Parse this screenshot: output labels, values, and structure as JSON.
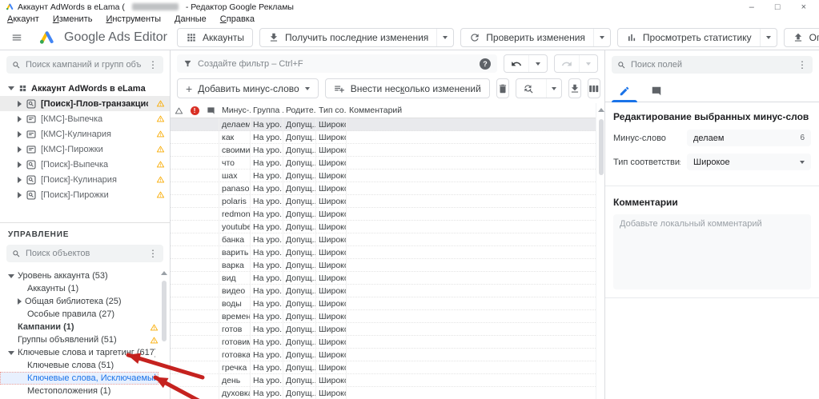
{
  "window": {
    "title_prefix": "Аккаунт AdWords в eLama (",
    "title_suffix": "- Редактор Google Рекламы"
  },
  "icons": {
    "more_vert": "⋮",
    "help_glyph": "?",
    "plus_glyph": "+",
    "minimize_glyph": "–",
    "maximize_glyph": "□",
    "close_glyph": "×"
  },
  "menubar": {
    "items": [
      {
        "label": "Аккаунт"
      },
      {
        "label": "Изменить"
      },
      {
        "label": "Инструменты"
      },
      {
        "label": "Данные"
      },
      {
        "label": "Справка"
      }
    ]
  },
  "toolbar": {
    "product_name": "Google Ads Editor",
    "buttons": [
      {
        "label": "Аккаунты",
        "icon": "grid",
        "dropdown": false
      },
      {
        "label": "Получить последние изменения",
        "icon": "download",
        "dropdown": true
      },
      {
        "label": "Проверить изменения",
        "icon": "refresh",
        "dropdown": true
      },
      {
        "label": "Просмотреть статистику",
        "icon": "chart",
        "dropdown": true
      },
      {
        "label": "Опубликовать",
        "icon": "upload",
        "dropdown": true
      }
    ]
  },
  "left_panel": {
    "campaign_search_placeholder": "Поиск кампаний и групп объявлений",
    "account_tree": {
      "root_label": "Аккаунт AdWords в eLama",
      "campaigns": [
        {
          "label": "[Поиск]-Плов-транзакционные",
          "type": "search",
          "selected": true,
          "warning": true
        },
        {
          "label": "[КМС]-Выпечка",
          "type": "display",
          "selected": false,
          "warning": true
        },
        {
          "label": "[КМС]-Кулинария",
          "type": "display",
          "selected": false,
          "warning": true
        },
        {
          "label": "[КМС]-Пирожки",
          "type": "display",
          "selected": false,
          "warning": true
        },
        {
          "label": "[Поиск]-Выпечка",
          "type": "search",
          "selected": false,
          "warning": true
        },
        {
          "label": "[Поиск]-Кулинария",
          "type": "search",
          "selected": false,
          "warning": true
        },
        {
          "label": "[Поиск]-Пирожки",
          "type": "search",
          "selected": false,
          "warning": true
        }
      ]
    },
    "management": {
      "heading": "УПРАВЛЕНИЕ",
      "search_placeholder": "Поиск объектов",
      "items": [
        {
          "label": "Уровень аккаунта (53)",
          "indent": 0,
          "caret": "down",
          "bold": false,
          "warning": false,
          "selected": false
        },
        {
          "label": "Аккаунты (1)",
          "indent": 1,
          "caret": "",
          "bold": false,
          "warning": false,
          "selected": false
        },
        {
          "label": "Общая библиотека (25)",
          "indent": 1,
          "caret": "right",
          "bold": false,
          "warning": false,
          "selected": false
        },
        {
          "label": "Особые правила (27)",
          "indent": 1,
          "caret": "",
          "bold": false,
          "warning": false,
          "selected": false
        },
        {
          "label": "Кампании (1)",
          "indent": 0,
          "caret": "",
          "bold": true,
          "warning": true,
          "selected": false
        },
        {
          "label": "Группы объявлений (51)",
          "indent": 0,
          "caret": "",
          "bold": false,
          "warning": true,
          "selected": false
        },
        {
          "label": "Ключевые слова и таргетинг (617)",
          "indent": 0,
          "caret": "down",
          "bold": false,
          "warning": false,
          "selected": false
        },
        {
          "label": "Ключевые слова (51)",
          "indent": 1,
          "caret": "",
          "bold": false,
          "warning": false,
          "selected": false
        },
        {
          "label": "Ключевые слова, Исключаемый критерий",
          "indent": 1,
          "caret": "",
          "bold": false,
          "warning": false,
          "selected": true
        },
        {
          "label": "Местоположения (1)",
          "indent": 1,
          "caret": "",
          "bold": false,
          "warning": false,
          "selected": false
        }
      ]
    }
  },
  "editor": {
    "filter_placeholder": "Создайте фильтр – Ctrl+F",
    "add_button_label": "Добавить минус-слово",
    "bulk_button_label": "Внести несколько изменений",
    "bulk_button_accel_index": 10,
    "table": {
      "columns": [
        "Минус-...",
        "Группа ...",
        "Родите...",
        "Тип со...",
        "Комментарий"
      ],
      "rows": [
        {
          "word": "делаем",
          "group": "На уро...",
          "parent": "Допущ...",
          "match_type": "Широкое",
          "comment": "",
          "selected": true
        },
        {
          "word": "как",
          "group": "На уро...",
          "parent": "Допущ...",
          "match_type": "Широкое",
          "comment": "",
          "selected": false
        },
        {
          "word": "своими",
          "group": "На уро...",
          "parent": "Допущ...",
          "match_type": "Широкое",
          "comment": "",
          "selected": false
        },
        {
          "word": "что",
          "group": "На уро...",
          "parent": "Допущ...",
          "match_type": "Широкое",
          "comment": "",
          "selected": false
        },
        {
          "word": "шах",
          "group": "На уро...",
          "parent": "Допущ...",
          "match_type": "Широкое",
          "comment": "",
          "selected": false
        },
        {
          "word": "panaso...",
          "group": "На уро...",
          "parent": "Допущ...",
          "match_type": "Широкое",
          "comment": "",
          "selected": false
        },
        {
          "word": "polaris",
          "group": "На уро...",
          "parent": "Допущ...",
          "match_type": "Широкое",
          "comment": "",
          "selected": false
        },
        {
          "word": "redmond",
          "group": "На уро...",
          "parent": "Допущ...",
          "match_type": "Широкое",
          "comment": "",
          "selected": false
        },
        {
          "word": "youtube",
          "group": "На уро...",
          "parent": "Допущ...",
          "match_type": "Широкое",
          "comment": "",
          "selected": false
        },
        {
          "word": "банка",
          "group": "На уро...",
          "parent": "Допущ...",
          "match_type": "Широкое",
          "comment": "",
          "selected": false
        },
        {
          "word": "варить",
          "group": "На уро...",
          "parent": "Допущ...",
          "match_type": "Широкое",
          "comment": "",
          "selected": false
        },
        {
          "word": "варка",
          "group": "На уро...",
          "parent": "Допущ...",
          "match_type": "Широкое",
          "comment": "",
          "selected": false
        },
        {
          "word": "вид",
          "group": "На уро...",
          "parent": "Допущ...",
          "match_type": "Широкое",
          "comment": "",
          "selected": false
        },
        {
          "word": "видео",
          "group": "На уро...",
          "parent": "Допущ...",
          "match_type": "Широкое",
          "comment": "",
          "selected": false
        },
        {
          "word": "воды",
          "group": "На уро...",
          "parent": "Допущ...",
          "match_type": "Широкое",
          "comment": "",
          "selected": false
        },
        {
          "word": "времени",
          "group": "На уро...",
          "parent": "Допущ...",
          "match_type": "Широкое",
          "comment": "",
          "selected": false
        },
        {
          "word": "готов",
          "group": "На уро...",
          "parent": "Допущ...",
          "match_type": "Широкое",
          "comment": "",
          "selected": false
        },
        {
          "word": "готовим",
          "group": "На уро...",
          "parent": "Допущ...",
          "match_type": "Широкое",
          "comment": "",
          "selected": false
        },
        {
          "word": "готовка",
          "group": "На уро...",
          "parent": "Допущ...",
          "match_type": "Широкое",
          "comment": "",
          "selected": false
        },
        {
          "word": "гречка",
          "group": "На уро...",
          "parent": "Допущ...",
          "match_type": "Широкое",
          "comment": "",
          "selected": false
        },
        {
          "word": "день",
          "group": "На уро...",
          "parent": "Допущ...",
          "match_type": "Широкое",
          "comment": "",
          "selected": false
        },
        {
          "word": "духовка",
          "group": "На уро...",
          "parent": "Допущ...",
          "match_type": "Широкое",
          "comment": "",
          "selected": false
        }
      ]
    }
  },
  "right_panel": {
    "search_placeholder": "Поиск полей",
    "heading": "Редактирование выбранных минус-слов",
    "minus_word_field": {
      "label": "Минус-слово",
      "value": "делаем",
      "badge": "6"
    },
    "match_type_field": {
      "label": "Тип соответствия",
      "value": "Широкое"
    },
    "comments_heading": "Комментарии",
    "comment_placeholder": "Добавьте локальный комментарий"
  },
  "annotation": {
    "arrow_color": "#c5221f"
  }
}
